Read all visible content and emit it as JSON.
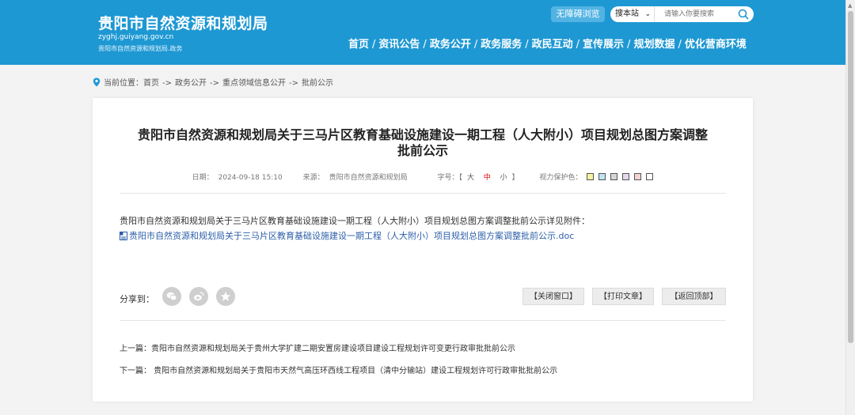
{
  "header": {
    "title": "贵阳市自然资源和规划局",
    "domain": "zyghj.guiyang.gov.cn",
    "subtitle": "贵阳市自然资源和规划局.政务",
    "accessibility_label": "无障碍浏览",
    "search_scope": "搜本站",
    "search_placeholder": "请输入你要搜索",
    "nav": [
      "首页",
      "资讯公告",
      "政务公开",
      "政务服务",
      "政民互动",
      "宣传展示",
      "规划数据",
      "优化营商环境"
    ]
  },
  "breadcrumb": {
    "prefix": "当前位置：",
    "items": [
      "首页",
      "政务公开",
      "重点领域信息公开",
      "批前公示"
    ],
    "separator": "->"
  },
  "article": {
    "title_line1": "贵阳市自然资源和规划局关于三马片区教育基础设施建设一期工程（人大附小）项目规划总图方案调整",
    "title_line2": "批前公示",
    "date_label": "日期：",
    "date": "2024-09-18 15:10",
    "source_label": "来源：",
    "source": "贵阳市自然资源和规划局",
    "font_label": "字号：【",
    "font_big": "大",
    "font_mid": "中",
    "font_small": "小",
    "font_close": "】",
    "eye_label": "视力保护色：",
    "eye_colors": [
      "#f6f3a3",
      "#bfe3f3",
      "#d6d6d6",
      "#e6d6ee",
      "#f3d3d3",
      "#ffffff"
    ],
    "body": "贵阳市自然资源和规划局关于三马片区教育基础设施建设一期工程（人大附小）项目规划总图方案调整批前公示详见附件：",
    "attachment": "贵阳市自然资源和规划局关于三马片区教育基础设施建设一期工程（人大附小）项目规划总图方案调整批前公示.doc"
  },
  "share": {
    "label": "分享到：",
    "icons": [
      "wechat-icon",
      "weibo-icon",
      "favorite-icon"
    ]
  },
  "actions": {
    "close": "【关闭窗口】",
    "print": "【打印文章】",
    "top": "【返回顶部】"
  },
  "pager": {
    "prev": "上一篇：贵阳市自然资源和规划局关于贵州大学扩建二期安置房建设项目建设工程规划许可变更行政审批批前公示",
    "next": "下一篇： 贵阳市自然资源和规划局关于贵阳市天然气高压环西线工程项目（清中分输站）建设工程规划许可行政审批批前公示"
  },
  "colors": {
    "header_bg": "#1e98d3",
    "link": "#2b5ea8"
  }
}
